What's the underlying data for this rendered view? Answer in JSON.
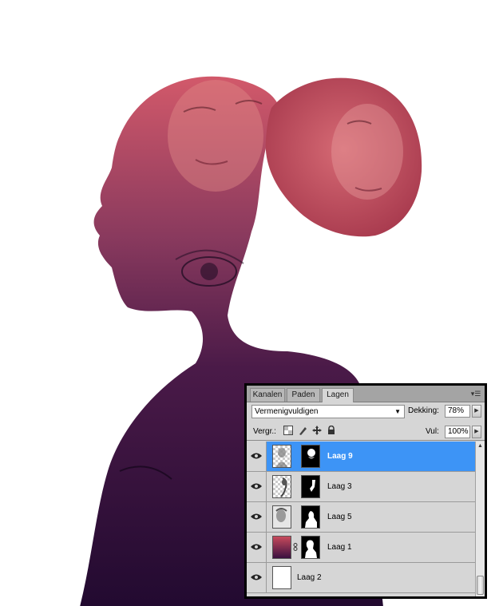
{
  "panel": {
    "tabs": [
      {
        "label": "Kanalen",
        "active": false
      },
      {
        "label": "Paden",
        "active": false
      },
      {
        "label": "Lagen",
        "active": true
      }
    ],
    "menu_icon": "panel-menu-icon",
    "blend_mode": "Vermenigvuldigen",
    "opacity_label": "Dekking:",
    "opacity_value": "78%",
    "lock_label": "Vergr.:",
    "lock_icons": [
      "lock-transparency-icon",
      "lock-paint-icon",
      "lock-move-icon",
      "lock-all-icon"
    ],
    "fill_label": "Vul:",
    "fill_value": "100%",
    "layers": [
      {
        "name": "Laag 9",
        "selected": true,
        "visible": true,
        "has_mask": true,
        "linked": false
      },
      {
        "name": "Laag 3",
        "selected": false,
        "visible": true,
        "has_mask": true,
        "linked": false
      },
      {
        "name": "Laag 5",
        "selected": false,
        "visible": true,
        "has_mask": true,
        "linked": false
      },
      {
        "name": "Laag 1",
        "selected": false,
        "visible": true,
        "has_mask": true,
        "linked": true
      },
      {
        "name": "Laag 2",
        "selected": false,
        "visible": true,
        "has_mask": false,
        "linked": false
      }
    ]
  },
  "colors": {
    "selection": "#3d94f6",
    "panel_bg": "#d6d6d6",
    "artwork_top": "#c24a5a",
    "artwork_bottom": "#2a0c38"
  }
}
